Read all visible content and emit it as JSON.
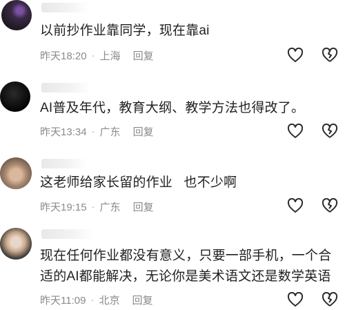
{
  "comments": [
    {
      "text": "以前抄作业靠同学，现在靠ai",
      "time": "昨天18:20",
      "location": "上海",
      "reply_label": "回复"
    },
    {
      "text": "AI普及年代，教育大纲、教学方法也得改了。",
      "time": "昨天13:34",
      "location": "广东",
      "reply_label": "回复"
    },
    {
      "text": "这老师给家长留的作业   也不少啊",
      "time": "昨天19:15",
      "location": "广东",
      "reply_label": "回复"
    },
    {
      "text_line1": "现在任何作业都没有意义，只要一部手机，一个合",
      "text_line2": "适的AI都能解决，无论你是美术语文还是数学英语",
      "time": "昨天11:09",
      "location": "北京",
      "reply_label": "回复"
    }
  ],
  "icons": {
    "like": "heart-icon",
    "dislike": "broken-heart-icon"
  },
  "colors": {
    "text": "#1f1f1f",
    "meta": "#8a8a8a"
  }
}
